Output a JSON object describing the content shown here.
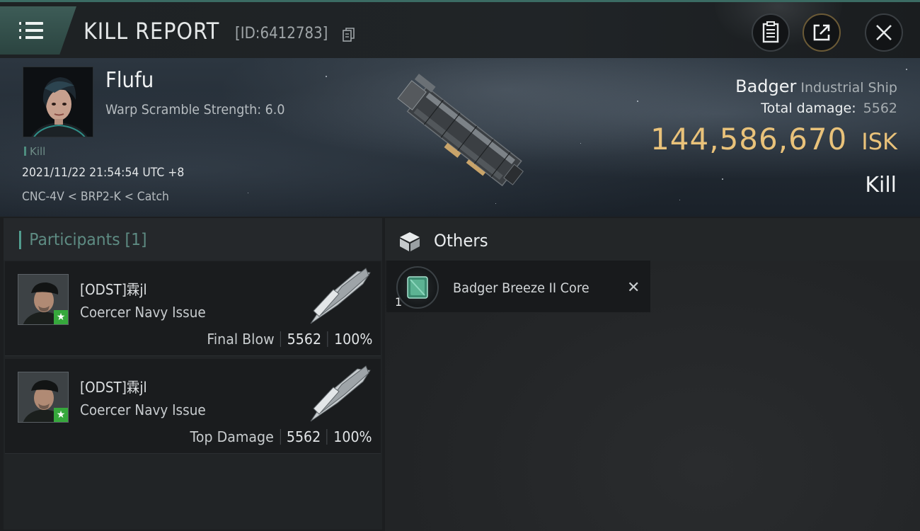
{
  "header": {
    "title": "KILL REPORT",
    "report_id": "[ID:6412783]"
  },
  "victim": {
    "name": "Flufu",
    "stat": "Warp Scramble Strength: 6.0",
    "tag": "Kill",
    "datetime": "2021/11/22 21:54:54 UTC +8",
    "location": "CNC-4V < BRP2-K < Catch",
    "ship_name": "Badger",
    "ship_class": "Industrial Ship",
    "total_damage_label": "Total damage:",
    "total_damage": "5562",
    "isk_value": "144,586,670",
    "isk_unit": "ISK",
    "result": "Kill"
  },
  "participants": {
    "title": "Participants [1]",
    "rows": [
      {
        "name": "[ODST]霖jl",
        "ship": "Coercer Navy Issue",
        "label": "Final Blow",
        "damage": "5562",
        "percent": "100%"
      },
      {
        "name": "[ODST]霖jl",
        "ship": "Coercer Navy Issue",
        "label": "Top Damage",
        "damage": "5562",
        "percent": "100%"
      }
    ]
  },
  "others": {
    "title": "Others",
    "items": [
      {
        "qty": "1",
        "name": "Badger Breeze II Core"
      }
    ]
  },
  "icons": [
    "menu-icon",
    "copy-icon",
    "clipboard-icon",
    "share-icon",
    "close-icon",
    "box-icon",
    "star-icon",
    "destroyed-icon"
  ],
  "colors": {
    "accent": "#54a394",
    "isk": "#e9c27a",
    "corp_star": "#36a83c"
  }
}
